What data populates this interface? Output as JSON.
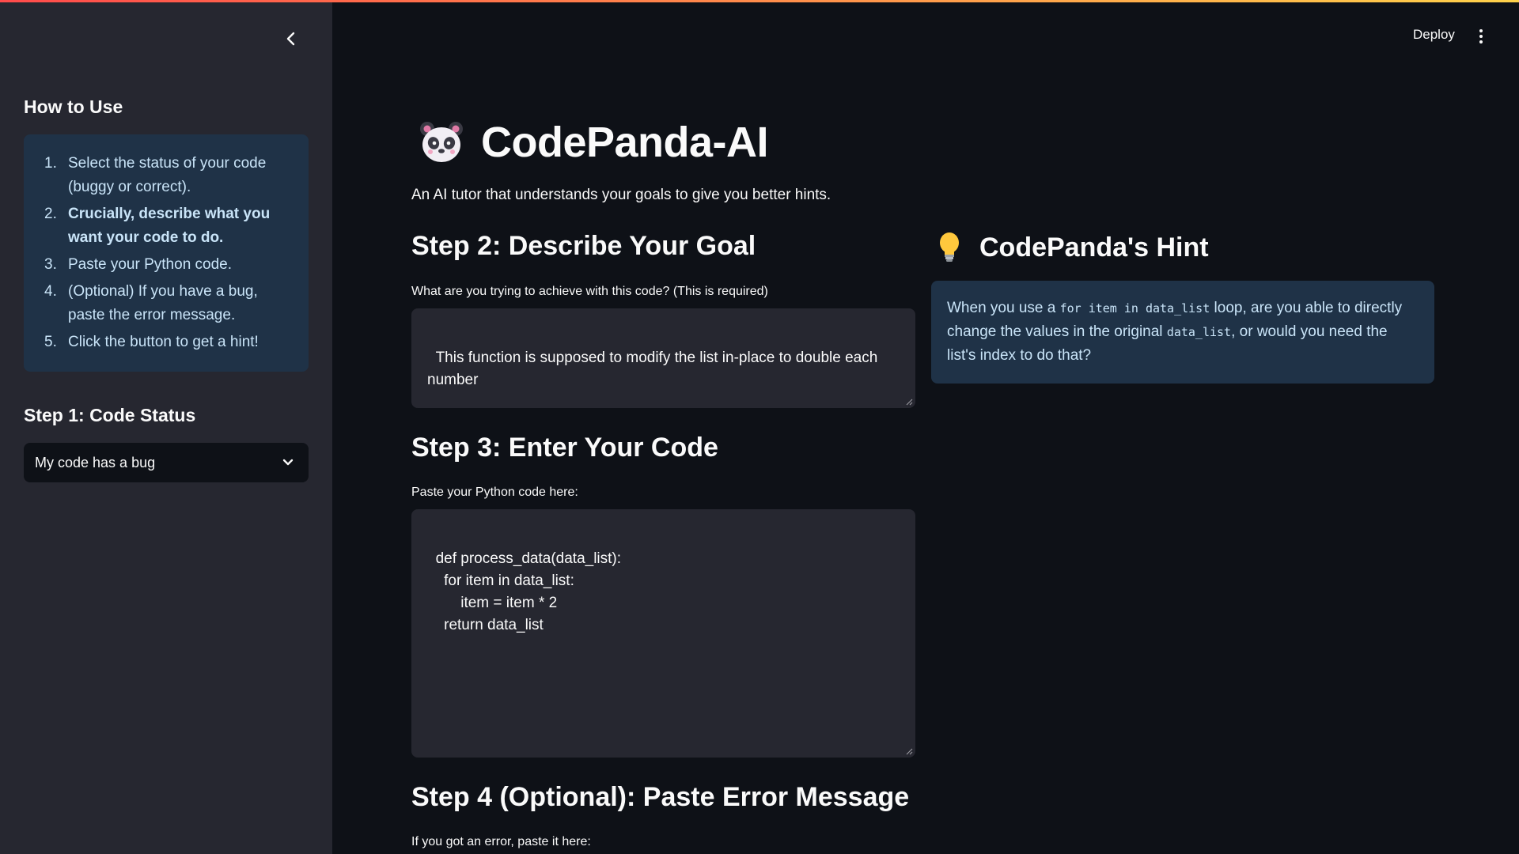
{
  "header": {
    "deploy_label": "Deploy",
    "menu_icon": "kebab-menu-icon"
  },
  "sidebar": {
    "collapse_icon": "chevron-left-icon",
    "how_to_heading": "How to Use",
    "steps": [
      {
        "num": "1.",
        "text": "Select the status of your code (buggy or correct)."
      },
      {
        "num": "2.",
        "text": "Crucially, describe what you want your code to do."
      },
      {
        "num": "3.",
        "text": "Paste your Python code."
      },
      {
        "num": "4.",
        "text": "(Optional) If you have a bug, paste the error message."
      },
      {
        "num": "5.",
        "text": "Click the button to get a hint!"
      }
    ],
    "status_heading": "Step 1: Code Status",
    "status_select_value": "My code has a bug"
  },
  "main": {
    "title": "CodePanda-AI",
    "subtitle": "An AI tutor that understands your goals to give you better hints.",
    "step2_heading": "Step 2: Describe Your Goal",
    "goal_label": "What are you trying to achieve with this code? (This is required)",
    "goal_value": "This function is supposed to modify the list in-place to double each number",
    "step3_heading": "Step 3: Enter Your Code",
    "code_label": "Paste your Python code here:",
    "code_value": "def process_data(data_list):\n    for item in data_list:\n        item = item * 2\n    return data_list",
    "step4_heading": "Step 4 (Optional): Paste Error Message",
    "error_label": "If you got an error, paste it here:"
  },
  "hint": {
    "heading": "CodePanda's Hint",
    "part1": "When you use a ",
    "code1": "for item in data_list",
    "part2": " loop, are you able to directly change the values in the original ",
    "code2": "data_list",
    "part3": ", or would you need the list's index to do that?"
  },
  "colors": {
    "background": "#0e1117",
    "sidebar": "#262730",
    "info_box": "#1f3247",
    "info_text": "#c9e4f8"
  }
}
